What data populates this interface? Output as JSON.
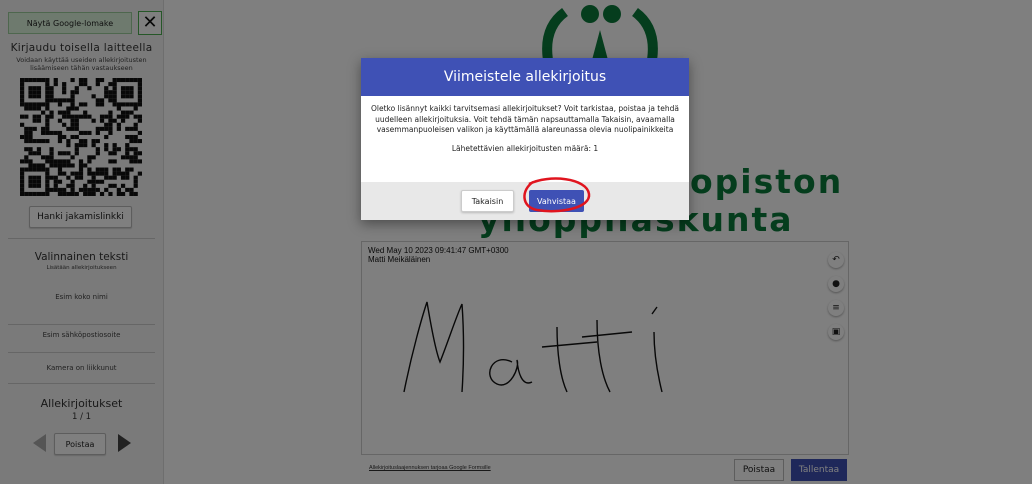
{
  "sidebar": {
    "show_form_label": "Näytä Google-lomake",
    "close_symbol": "✕",
    "login_title": "Kirjaudu toisella laitteella",
    "login_subtitle_1": "Voidaan käyttää useiden allekirjoitusten",
    "login_subtitle_2": "lisäämiseen tähän vastaukseen",
    "share_link_label": "Hanki jakamislinkki",
    "optional_text_title": "Valinnainen teksti",
    "optional_text_subtitle": "Lisätään allekirjoitukseen",
    "field_name_placeholder": "Esim koko nimi",
    "field_email_placeholder": "Esim sähköpostiosoite",
    "camera_status": "Kamera on liikkunut",
    "signatures_title": "Allekirjoitukset",
    "signatures_counter": "1 / 1",
    "delete_label": "Poistaa"
  },
  "background": {
    "line1": "opiston",
    "line2": "ylioppilaskunta"
  },
  "canvas": {
    "timestamp": "Wed May 10 2023 09:41:47 GMT+0300",
    "name": "Matti Meikäläinen",
    "handwriting_text": "Matti",
    "tools": [
      "undo-icon",
      "palette-icon",
      "menu-icon",
      "camera-icon"
    ]
  },
  "footer": {
    "link_text": "Allekirjoituslaajennuksen tarjoaa Google Formsille",
    "delete_label": "Poistaa",
    "save_label": "Tallentaa"
  },
  "dialog": {
    "title": "Viimeistele allekirjoitus",
    "body": "Oletko lisännyt kaikki tarvitsemasi allekirjoitukset? Voit tarkistaa, poistaa ja tehdä uudelleen allekirjoituksia. Voit tehdä tämän napsauttamalla Takaisin, avaamalla vasemmanpuoleisen valikon ja käyttämällä alareunassa olevia nuolipainikkeita",
    "count_text": "Lähetettävien allekirjoitusten määrä: 1",
    "back_label": "Takaisin",
    "confirm_label": "Vahvistaa"
  },
  "colors": {
    "accent": "#3f51b5",
    "brand_green": "#0b7a3b",
    "annotation_red": "#e0141e"
  }
}
